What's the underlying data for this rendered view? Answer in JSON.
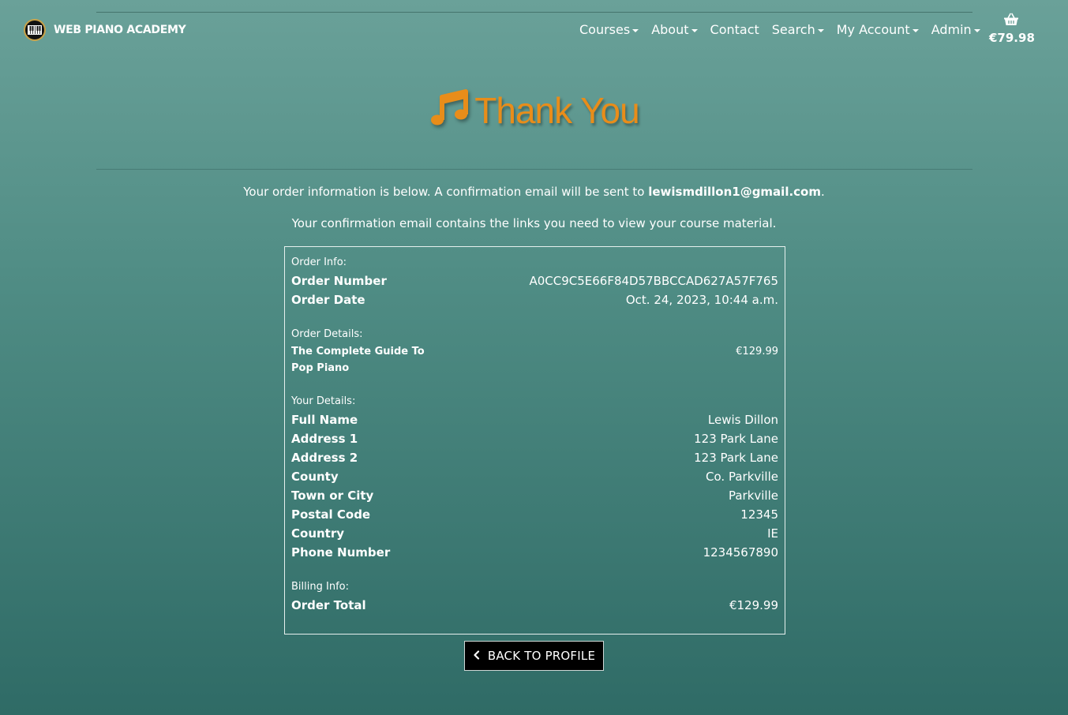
{
  "brand": {
    "name": "WEB PIANO ACADEMY"
  },
  "nav": {
    "items": [
      {
        "label": "Courses",
        "dropdown": true
      },
      {
        "label": "About",
        "dropdown": true
      },
      {
        "label": "Contact",
        "dropdown": false
      },
      {
        "label": "Search",
        "dropdown": true
      },
      {
        "label": "My Account",
        "dropdown": true
      },
      {
        "label": "Admin",
        "dropdown": true
      }
    ],
    "cart_total": "€79.98"
  },
  "hero": {
    "title": "Thank You",
    "icon": "music-note-icon",
    "color": "#e88d1a"
  },
  "message": {
    "line1_prefix": "Your order information is below. A confirmation email will be sent to ",
    "email": "lewismdillon1@gmail.com",
    "line1_suffix": ".",
    "line2": "Your confirmation email contains the links you need to view your course material."
  },
  "order_info": {
    "heading": "Order Info:",
    "rows": [
      {
        "label": "Order Number",
        "value": "A0CC9C5E66F84D57BBCCAD627A57F765"
      },
      {
        "label": "Order Date",
        "value": "Oct. 24, 2023, 10:44 a.m."
      }
    ]
  },
  "order_details": {
    "heading": "Order Details:",
    "course_name": "The Complete Guide To Pop Piano",
    "course_price": "€129.99"
  },
  "your_details": {
    "heading": "Your Details:",
    "rows": [
      {
        "label": "Full Name",
        "value": "Lewis Dillon"
      },
      {
        "label": "Address 1",
        "value": "123 Park Lane"
      },
      {
        "label": "Address 2",
        "value": "123 Park Lane"
      },
      {
        "label": "County",
        "value": "Co. Parkville"
      },
      {
        "label": "Town or City",
        "value": "Parkville"
      },
      {
        "label": "Postal Code",
        "value": "12345"
      },
      {
        "label": "Country",
        "value": "IE"
      },
      {
        "label": "Phone Number",
        "value": "1234567890"
      }
    ]
  },
  "billing_info": {
    "heading": "Billing Info:",
    "rows": [
      {
        "label": "Order Total",
        "value": "€129.99"
      }
    ]
  },
  "button": {
    "label": "BACK TO PROFILE",
    "icon": "chevron-left-icon"
  }
}
